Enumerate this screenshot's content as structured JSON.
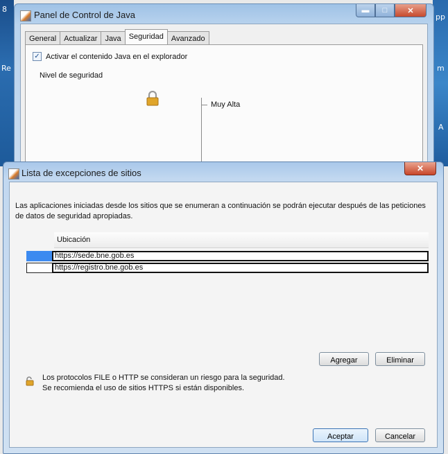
{
  "desktop": {
    "left_snippets": [
      "8",
      "Re"
    ],
    "right_snippets": [
      "pp",
      "m",
      "A"
    ]
  },
  "back_window": {
    "title": "Panel de Control de Java",
    "tabs": [
      "General",
      "Actualizar",
      "Java",
      "Seguridad",
      "Avanzado"
    ],
    "active_tab": "Seguridad",
    "enable_java_checkbox": {
      "label": "Activar el contenido Java en el explorador",
      "checked": true
    },
    "security_level_label": "Nivel de seguridad",
    "level_label": "Muy Alta"
  },
  "dialog": {
    "title": "Lista de excepciones de sitios",
    "description": "Las aplicaciones iniciadas desde los sitios que se enumeran a continuación se podrán ejecutar después de las peticiones de datos de seguridad apropiadas.",
    "table": {
      "column_header": "Ubicación",
      "rows": [
        "https://sede.bne.gob.es",
        "https://registro.bne.gob.es"
      ]
    },
    "add_button": "Agregar",
    "remove_button": "Eliminar",
    "warning_line1": "Los protocolos FILE o HTTP se consideran un riesgo para la seguridad.",
    "warning_line2": "Se recomienda el uso de sitios HTTPS si están disponibles.",
    "ok_button": "Aceptar",
    "cancel_button": "Cancelar"
  }
}
